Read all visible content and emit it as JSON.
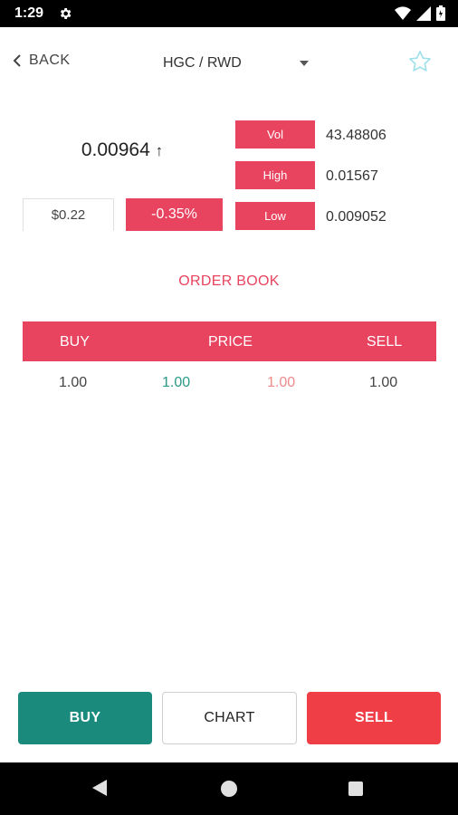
{
  "status_bar": {
    "time": "1:29"
  },
  "header": {
    "back_label": "BACK",
    "pair": "HGC / RWD"
  },
  "ticker": {
    "last_price": "0.00964",
    "trend_arrow": "↑",
    "usd_price": "$0.22",
    "change": "-0.35%"
  },
  "stats": {
    "vol_label": "Vol",
    "vol_value": "43.48806",
    "high_label": "High",
    "high_value": "0.01567",
    "low_label": "Low",
    "low_value": "0.009052"
  },
  "order_book": {
    "title": "ORDER BOOK",
    "columns": {
      "buy": "BUY",
      "price": "PRICE",
      "sell": "SELL"
    },
    "rows": [
      {
        "buy_qty": "1.00",
        "buy_price": "1.00",
        "sell_price": "1.00",
        "sell_qty": "1.00"
      }
    ]
  },
  "actions": {
    "buy": "BUY",
    "chart": "CHART",
    "sell": "SELL"
  },
  "colors": {
    "accent": "#e8435f",
    "buy": "#1a8a7c",
    "sell": "#ef3e45",
    "buy_price_text": "#2a9a86",
    "sell_price_text": "#f08a8a"
  },
  "icons": [
    "settings-gear-icon",
    "wifi-icon",
    "signal-icon",
    "battery-icon",
    "chevron-left-icon",
    "dropdown-caret-icon",
    "star-outline-icon",
    "nav-back-icon",
    "nav-home-icon",
    "nav-recents-icon"
  ]
}
